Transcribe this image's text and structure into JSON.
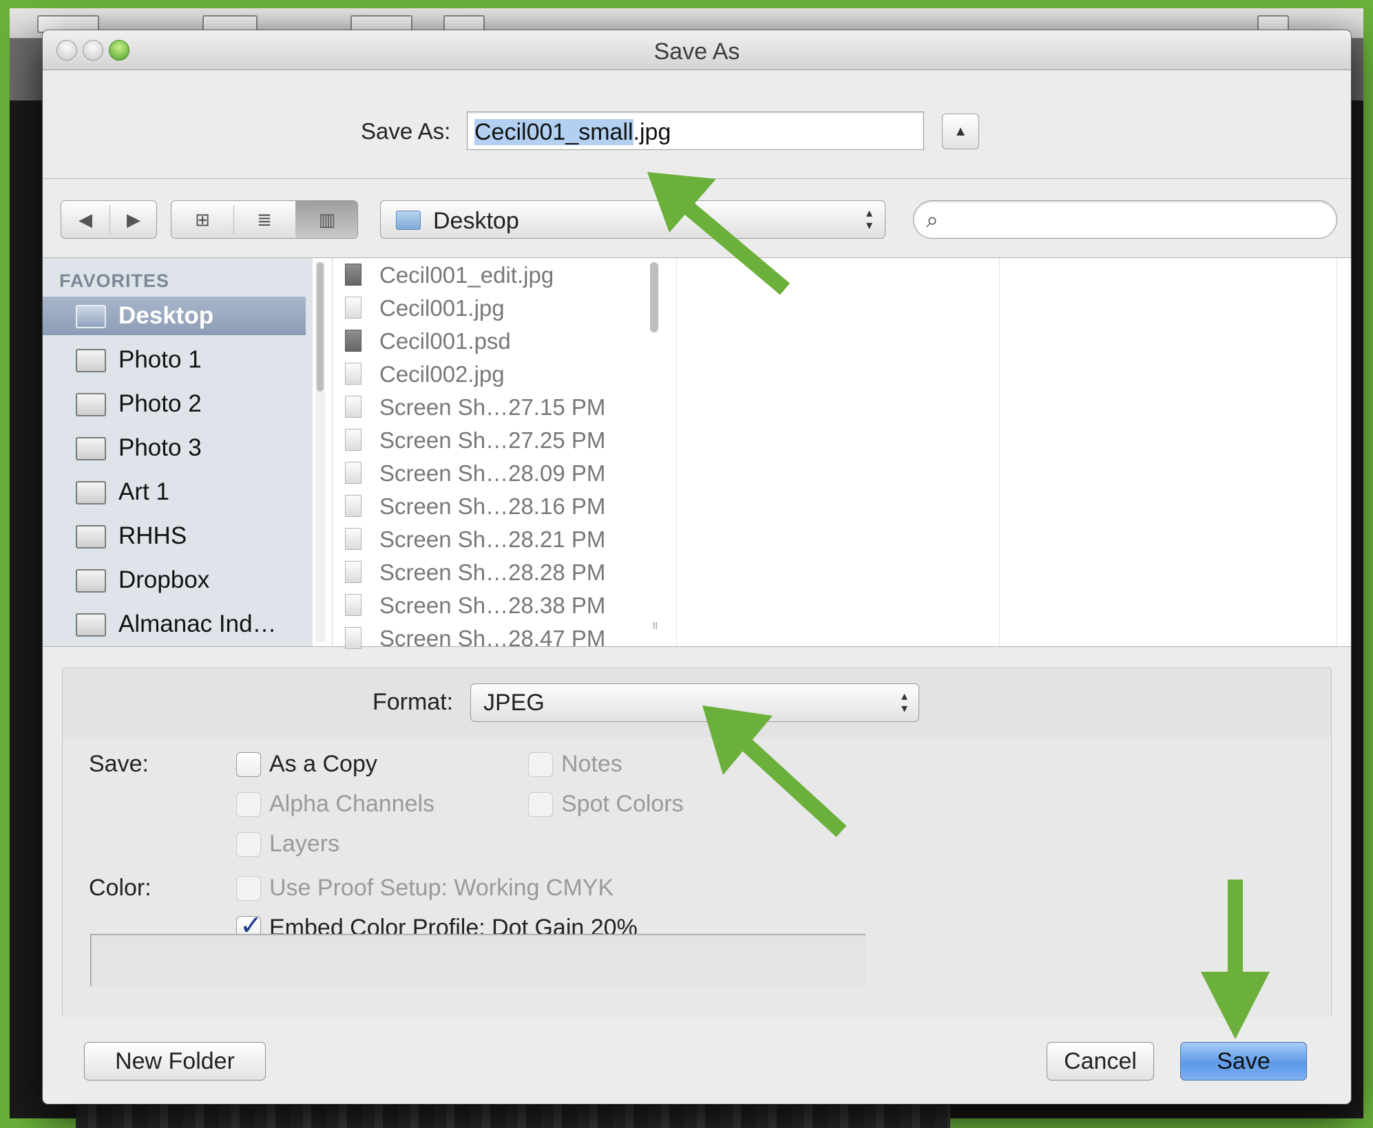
{
  "dialog": {
    "title": "Save As",
    "save_as_label": "Save As:",
    "filename_selected": "Cecil001_small",
    "filename_ext": ".jpg",
    "expand_symbol": "▲"
  },
  "nav": {
    "back_symbol": "◀",
    "forward_symbol": "▶",
    "view_icon_symbol": "⊞",
    "view_list_symbol": "≣",
    "view_column_symbol": "▥",
    "location": "Desktop",
    "search_placeholder": "",
    "search_icon": "search-icon"
  },
  "sidebar": {
    "heading": "FAVORITES",
    "items": [
      {
        "label": "Desktop",
        "selected": true
      },
      {
        "label": "Photo 1"
      },
      {
        "label": "Photo 2"
      },
      {
        "label": "Photo 3"
      },
      {
        "label": "Art 1"
      },
      {
        "label": "RHHS"
      },
      {
        "label": "Dropbox"
      },
      {
        "label": "Almanac Ind…"
      }
    ]
  },
  "files": [
    {
      "name": "Cecil001_edit.jpg",
      "kind": "psd"
    },
    {
      "name": "Cecil001.jpg",
      "kind": "jpg"
    },
    {
      "name": "Cecil001.psd",
      "kind": "psd"
    },
    {
      "name": "Cecil002.jpg",
      "kind": "jpg"
    },
    {
      "name": "Screen Sh…27.15 PM",
      "kind": "jpg"
    },
    {
      "name": "Screen Sh…27.25 PM",
      "kind": "jpg"
    },
    {
      "name": "Screen Sh…28.09 PM",
      "kind": "jpg"
    },
    {
      "name": "Screen Sh…28.16 PM",
      "kind": "jpg"
    },
    {
      "name": "Screen Sh…28.21 PM",
      "kind": "jpg"
    },
    {
      "name": "Screen Sh…28.28 PM",
      "kind": "jpg"
    },
    {
      "name": "Screen Sh…28.38 PM",
      "kind": "jpg"
    },
    {
      "name": "Screen Sh…28.47 PM",
      "kind": "jpg"
    }
  ],
  "options": {
    "format_label": "Format:",
    "format_value": "JPEG",
    "save_label": "Save:",
    "color_label": "Color:",
    "as_a_copy": "As a Copy",
    "notes": "Notes",
    "alpha_channels": "Alpha Channels",
    "spot_colors": "Spot Colors",
    "layers": "Layers",
    "use_proof_setup": "Use Proof Setup:  Working CMYK",
    "embed_color_profile": "Embed Color Profile:  Dot Gain 20%"
  },
  "buttons": {
    "new_folder": "New Folder",
    "cancel": "Cancel",
    "save": "Save"
  },
  "colors": {
    "frame_green": "#6ab03a",
    "arrow_green": "#6ab03a",
    "selection_blue": "#b3d0f2",
    "save_button_blue": "#5e9ae8"
  }
}
